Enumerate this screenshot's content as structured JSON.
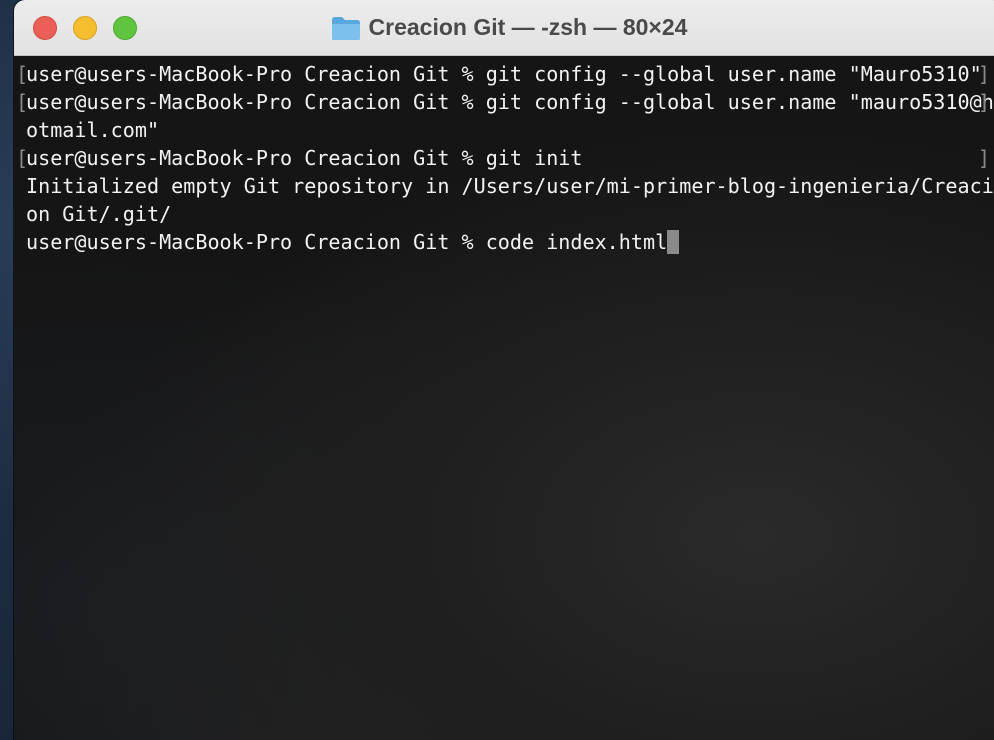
{
  "window": {
    "title": "Creacion Git — -zsh — 80×24",
    "title_icon": "folder-icon"
  },
  "terminal": {
    "lines": [
      {
        "text": "user@users-MacBook-Pro Creacion Git % git config --global user.name \"Mauro5310\"",
        "marked": true
      },
      {
        "text": "user@users-MacBook-Pro Creacion Git % git config --global user.name \"mauro5310@h",
        "marked": true
      },
      {
        "text": "otmail.com\"",
        "marked": false
      },
      {
        "text": "user@users-MacBook-Pro Creacion Git % git init",
        "marked": true
      },
      {
        "text": "Initialized empty Git repository in /Users/user/mi-primer-blog-ingenieria/Creaci",
        "marked": false
      },
      {
        "text": "on Git/.git/",
        "marked": false
      },
      {
        "text": "user@users-MacBook-Pro Creacion Git % code index.html",
        "marked": false
      }
    ],
    "cursor": "block"
  },
  "colors": {
    "close": "#ec5f57",
    "minimize": "#f5be2e",
    "zoom": "#5fc53f",
    "terminal_text": "#f2f2f2",
    "terminal_bg": "#151515",
    "titlebar": "#e8e8e8"
  }
}
